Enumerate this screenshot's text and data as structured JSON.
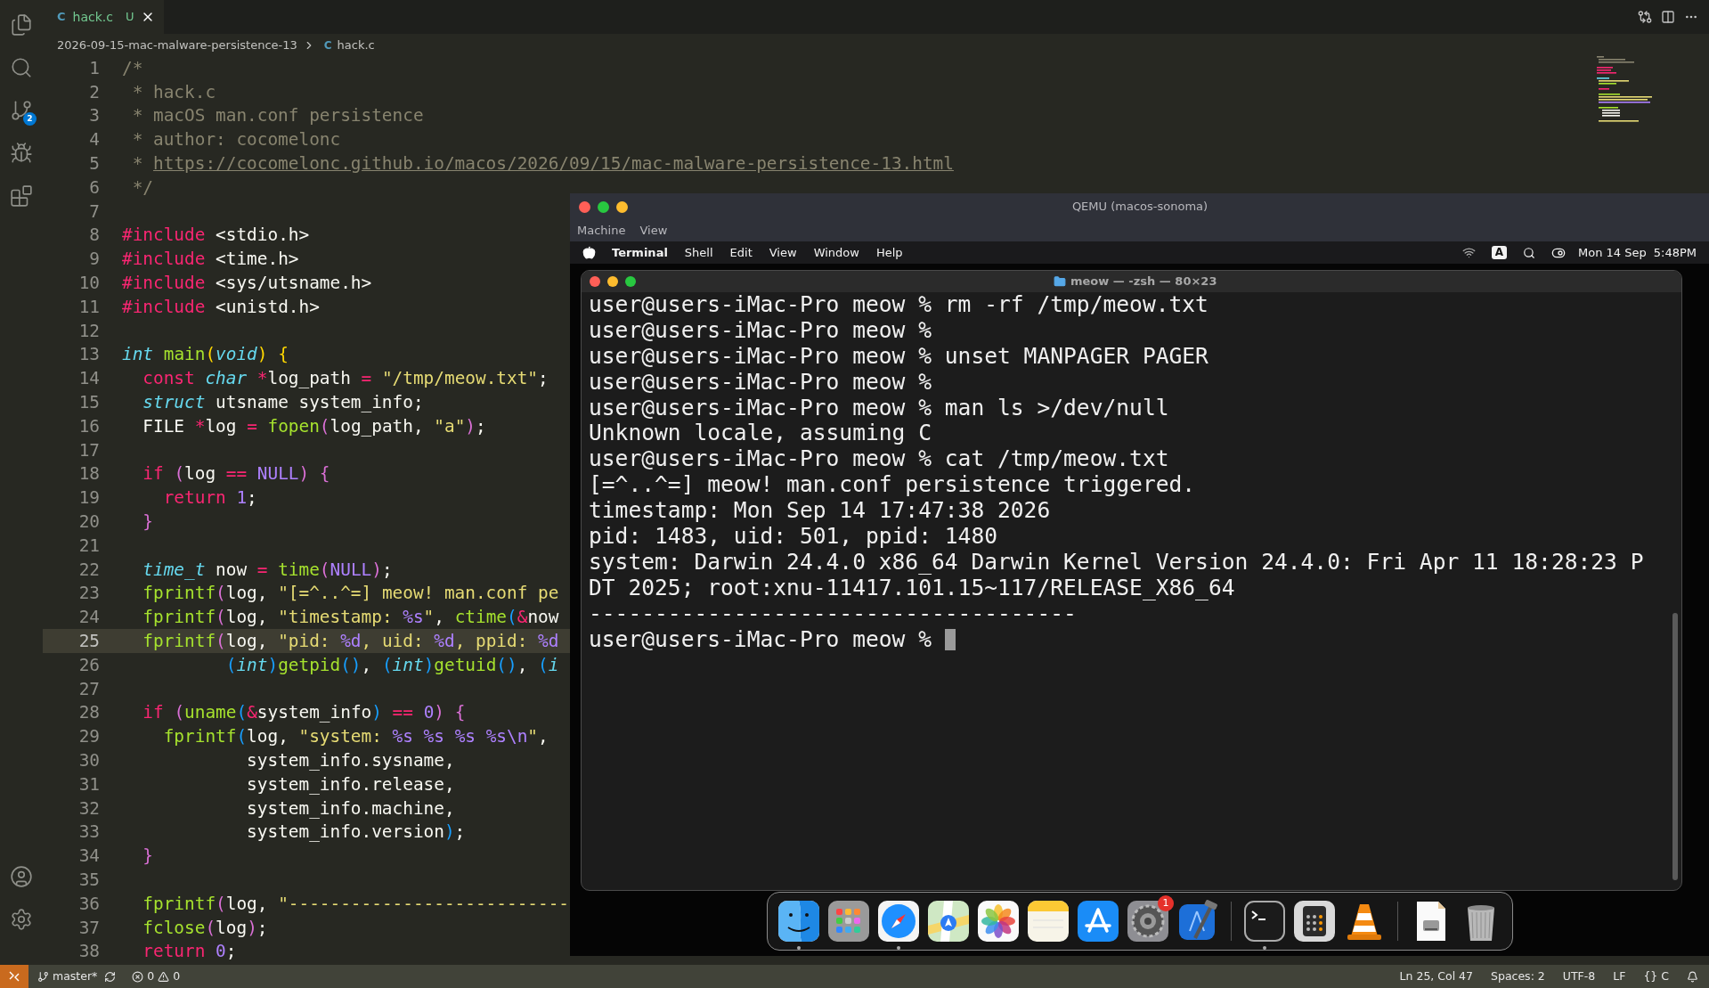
{
  "activity_bar": {
    "top": [
      {
        "kind": "explorer"
      },
      {
        "kind": "search"
      },
      {
        "kind": "source_control",
        "badge": "2"
      },
      {
        "kind": "run_debug"
      },
      {
        "kind": "extensions"
      }
    ],
    "bottom": [
      {
        "kind": "account"
      },
      {
        "kind": "settings"
      }
    ]
  },
  "tabs": [
    {
      "icon": "C",
      "label": "hack.c",
      "status": "U",
      "selected": true
    }
  ],
  "breadcrumb": {
    "folder": "2026-09-15-mac-malware-persistence-13",
    "file_icon": "C",
    "file": "hack.c"
  },
  "code": [
    {
      "number": "1",
      "current": false,
      "tokens": [
        {
          "kind": "comment",
          "text": "/*"
        }
      ]
    },
    {
      "number": "2",
      "current": false,
      "tokens": [
        {
          "kind": "comment",
          "text": " * hack.c"
        }
      ]
    },
    {
      "number": "3",
      "current": false,
      "tokens": [
        {
          "kind": "comment",
          "text": " * macOS man.conf persistence"
        }
      ]
    },
    {
      "number": "4",
      "current": false,
      "tokens": [
        {
          "kind": "comment",
          "text": " * author: cocomelonc"
        }
      ]
    },
    {
      "number": "5",
      "current": false,
      "tokens": [
        {
          "kind": "comment",
          "text": " * "
        },
        {
          "kind": "link",
          "text": "https://cocomelonc.github.io/macos/2026/09/15/mac-malware-persistence-13.html"
        }
      ]
    },
    {
      "number": "6",
      "current": false,
      "tokens": [
        {
          "kind": "comment",
          "text": " */"
        }
      ]
    },
    {
      "number": "7",
      "current": false
    },
    {
      "number": "8",
      "current": false,
      "tokens": [
        {
          "kind": "keyword",
          "text": "#include"
        },
        {
          "kind": "plain",
          "text": " <stdio.h>"
        }
      ]
    },
    {
      "number": "9",
      "current": false,
      "tokens": [
        {
          "kind": "keyword",
          "text": "#include"
        },
        {
          "kind": "plain",
          "text": " <time.h>"
        }
      ]
    },
    {
      "number": "10",
      "current": false,
      "tokens": [
        {
          "kind": "keyword",
          "text": "#include"
        },
        {
          "kind": "plain",
          "text": " <sys/utsname.h>"
        }
      ]
    },
    {
      "number": "11",
      "current": false,
      "tokens": [
        {
          "kind": "keyword",
          "text": "#include"
        },
        {
          "kind": "plain",
          "text": " <unistd.h>"
        }
      ]
    },
    {
      "number": "12",
      "current": false
    },
    {
      "number": "13",
      "current": false,
      "tokens": [
        {
          "kind": "type",
          "text": "int "
        },
        {
          "kind": "function",
          "text": "main"
        },
        {
          "kind": "bracket1",
          "text": "("
        },
        {
          "kind": "type",
          "text": "void"
        },
        {
          "kind": "bracket1",
          "text": ") {"
        }
      ]
    },
    {
      "number": "14",
      "current": false,
      "tokens": [
        {
          "kind": "keyword",
          "text": "  const "
        },
        {
          "kind": "type",
          "text": "char "
        },
        {
          "kind": "keyword",
          "text": "*"
        },
        {
          "kind": "plain",
          "text": "log_path "
        },
        {
          "kind": "keyword",
          "text": "= "
        },
        {
          "kind": "string",
          "text": "\"/tmp/meow.txt\""
        },
        {
          "kind": "plain",
          "text": ";"
        }
      ]
    },
    {
      "number": "15",
      "current": false,
      "tokens": [
        {
          "kind": "type",
          "text": "  struct"
        },
        {
          "kind": "plain",
          "text": " utsname system_info;"
        }
      ]
    },
    {
      "number": "16",
      "current": false,
      "tokens": [
        {
          "kind": "plain",
          "text": "  FILE "
        },
        {
          "kind": "keyword",
          "text": "*"
        },
        {
          "kind": "plain",
          "text": "log "
        },
        {
          "kind": "keyword",
          "text": "= "
        },
        {
          "kind": "function",
          "text": "fopen"
        },
        {
          "kind": "bracket2",
          "text": "("
        },
        {
          "kind": "plain",
          "text": "log_path, "
        },
        {
          "kind": "string",
          "text": "\"a\""
        },
        {
          "kind": "bracket2",
          "text": ")"
        },
        {
          "kind": "plain",
          "text": ";"
        }
      ]
    },
    {
      "number": "17",
      "current": false
    },
    {
      "number": "18",
      "current": false,
      "tokens": [
        {
          "kind": "keyword",
          "text": "  if "
        },
        {
          "kind": "bracket2",
          "text": "("
        },
        {
          "kind": "plain",
          "text": "log "
        },
        {
          "kind": "keyword",
          "text": "== "
        },
        {
          "kind": "constant",
          "text": "NULL"
        },
        {
          "kind": "bracket2",
          "text": ") {"
        }
      ]
    },
    {
      "number": "19",
      "current": false,
      "tokens": [
        {
          "kind": "keyword",
          "text": "    return "
        },
        {
          "kind": "constant",
          "text": "1"
        },
        {
          "kind": "plain",
          "text": ";"
        }
      ]
    },
    {
      "number": "20",
      "current": false,
      "tokens": [
        {
          "kind": "bracket2",
          "text": "  }"
        }
      ]
    },
    {
      "number": "21",
      "current": false
    },
    {
      "number": "22",
      "current": false,
      "tokens": [
        {
          "kind": "type",
          "text": "  time_t"
        },
        {
          "kind": "plain",
          "text": " now "
        },
        {
          "kind": "keyword",
          "text": "= "
        },
        {
          "kind": "function",
          "text": "time"
        },
        {
          "kind": "bracket2",
          "text": "("
        },
        {
          "kind": "constant",
          "text": "NULL"
        },
        {
          "kind": "bracket2",
          "text": ")"
        },
        {
          "kind": "plain",
          "text": ";"
        }
      ]
    },
    {
      "number": "23",
      "current": false,
      "tokens": [
        {
          "kind": "function",
          "text": "  fprintf"
        },
        {
          "kind": "bracket2",
          "text": "("
        },
        {
          "kind": "plain",
          "text": "log, "
        },
        {
          "kind": "string",
          "text": "\"[=^..^=] meow! man.conf pe"
        }
      ]
    },
    {
      "number": "24",
      "current": false,
      "tokens": [
        {
          "kind": "function",
          "text": "  fprintf"
        },
        {
          "kind": "bracket2",
          "text": "("
        },
        {
          "kind": "plain",
          "text": "log, "
        },
        {
          "kind": "string",
          "text": "\"timestamp: "
        },
        {
          "kind": "constant",
          "text": "%s"
        },
        {
          "kind": "string",
          "text": "\""
        },
        {
          "kind": "plain",
          "text": ", "
        },
        {
          "kind": "function",
          "text": "ctime"
        },
        {
          "kind": "bracket3",
          "text": "("
        },
        {
          "kind": "keyword",
          "text": "&"
        },
        {
          "kind": "plain",
          "text": "now"
        }
      ]
    },
    {
      "number": "25",
      "current": true,
      "tokens": [
        {
          "kind": "function",
          "text": "  fprintf"
        },
        {
          "kind": "bracket2",
          "text": "("
        },
        {
          "kind": "plain",
          "text": "log, "
        },
        {
          "kind": "string",
          "text": "\"pid: "
        },
        {
          "kind": "constant",
          "text": "%d"
        },
        {
          "kind": "string",
          "text": ", uid: "
        },
        {
          "kind": "constant",
          "text": "%d"
        },
        {
          "kind": "string",
          "text": ", ppid: "
        },
        {
          "kind": "constant",
          "text": "%d"
        }
      ]
    },
    {
      "number": "26",
      "current": false,
      "tokens": [
        {
          "kind": "bracket3",
          "text": "          ("
        },
        {
          "kind": "type",
          "text": "int"
        },
        {
          "kind": "bracket3",
          "text": ")"
        },
        {
          "kind": "function",
          "text": "getpid"
        },
        {
          "kind": "bracket3",
          "text": "()"
        },
        {
          "kind": "plain",
          "text": ", "
        },
        {
          "kind": "bracket3",
          "text": "("
        },
        {
          "kind": "type",
          "text": "int"
        },
        {
          "kind": "bracket3",
          "text": ")"
        },
        {
          "kind": "function",
          "text": "getuid"
        },
        {
          "kind": "bracket3",
          "text": "()"
        },
        {
          "kind": "plain",
          "text": ", "
        },
        {
          "kind": "bracket3",
          "text": "("
        },
        {
          "kind": "type",
          "text": "i"
        }
      ]
    },
    {
      "number": "27",
      "current": false
    },
    {
      "number": "28",
      "current": false,
      "tokens": [
        {
          "kind": "keyword",
          "text": "  if "
        },
        {
          "kind": "bracket2",
          "text": "("
        },
        {
          "kind": "function",
          "text": "uname"
        },
        {
          "kind": "bracket3",
          "text": "("
        },
        {
          "kind": "keyword",
          "text": "&"
        },
        {
          "kind": "plain",
          "text": "system_info"
        },
        {
          "kind": "bracket3",
          "text": ") "
        },
        {
          "kind": "keyword",
          "text": "== "
        },
        {
          "kind": "constant",
          "text": "0"
        },
        {
          "kind": "bracket2",
          "text": ") {"
        }
      ]
    },
    {
      "number": "29",
      "current": false,
      "tokens": [
        {
          "kind": "function",
          "text": "    fprintf"
        },
        {
          "kind": "bracket3",
          "text": "("
        },
        {
          "kind": "plain",
          "text": "log, "
        },
        {
          "kind": "string",
          "text": "\"system: "
        },
        {
          "kind": "constant",
          "text": "%s "
        },
        {
          "kind": "constant",
          "text": "%s "
        },
        {
          "kind": "constant",
          "text": "%s "
        },
        {
          "kind": "constant",
          "text": "%s\\n"
        },
        {
          "kind": "string",
          "text": "\""
        },
        {
          "kind": "plain",
          "text": ","
        }
      ]
    },
    {
      "number": "30",
      "current": false,
      "tokens": [
        {
          "kind": "plain",
          "text": "            system_info.sysname,"
        }
      ]
    },
    {
      "number": "31",
      "current": false,
      "tokens": [
        {
          "kind": "plain",
          "text": "            system_info.release,"
        }
      ]
    },
    {
      "number": "32",
      "current": false,
      "tokens": [
        {
          "kind": "plain",
          "text": "            system_info.machine,"
        }
      ]
    },
    {
      "number": "33",
      "current": false,
      "tokens": [
        {
          "kind": "plain",
          "text": "            system_info.version"
        },
        {
          "kind": "bracket3",
          "text": ")"
        },
        {
          "kind": "plain",
          "text": ";"
        }
      ]
    },
    {
      "number": "34",
      "current": false,
      "tokens": [
        {
          "kind": "bracket2",
          "text": "  }"
        }
      ]
    },
    {
      "number": "35",
      "current": false
    },
    {
      "number": "36",
      "current": false,
      "tokens": [
        {
          "kind": "function",
          "text": "  fprintf"
        },
        {
          "kind": "bracket2",
          "text": "("
        },
        {
          "kind": "plain",
          "text": "log, "
        },
        {
          "kind": "string",
          "text": "\"---------------------------"
        }
      ]
    },
    {
      "number": "37",
      "current": false,
      "tokens": [
        {
          "kind": "function",
          "text": "  fclose"
        },
        {
          "kind": "bracket2",
          "text": "("
        },
        {
          "kind": "plain",
          "text": "log"
        },
        {
          "kind": "bracket2",
          "text": ")"
        },
        {
          "kind": "plain",
          "text": ";"
        }
      ]
    },
    {
      "number": "38",
      "current": false,
      "tokens": [
        {
          "kind": "keyword",
          "text": "  return "
        },
        {
          "kind": "constant",
          "text": "0"
        },
        {
          "kind": "plain",
          "text": ";"
        }
      ]
    }
  ],
  "qemu": {
    "title": "QEMU (macos-sonoma)",
    "menu": [
      "Machine",
      "View"
    ],
    "mac_menu_bar": {
      "app": "Terminal",
      "items": [
        "Shell",
        "Edit",
        "View",
        "Window",
        "Help"
      ],
      "input_source": "A",
      "date": "Mon 14 Sep",
      "time": "5:48PM"
    },
    "terminal": {
      "title": "meow — -zsh — 80×23",
      "lines": [
        "user@users-iMac-Pro meow % rm -rf /tmp/meow.txt",
        "user@users-iMac-Pro meow %",
        "user@users-iMac-Pro meow % unset MANPAGER PAGER",
        "user@users-iMac-Pro meow %",
        "user@users-iMac-Pro meow % man ls >/dev/null",
        "Unknown locale, assuming C",
        "user@users-iMac-Pro meow % cat /tmp/meow.txt",
        "[=^..^=] meow! man.conf persistence triggered.",
        "timestamp: Mon Sep 14 17:47:38 2026",
        "pid: 1483, uid: 501, ppid: 1480",
        "system: Darwin 24.4.0 x86_64 Darwin Kernel Version 24.4.0: Fri Apr 11 18:28:23 P",
        "DT 2025; root:xnu-11417.101.15~117/RELEASE_X86_64",
        "-------------------------------------"
      ],
      "prompt": "user@users-iMac-Pro meow %",
      "cursor_visible": true
    },
    "dock": [
      {
        "kind": "finder",
        "running": true
      },
      {
        "kind": "launchpad",
        "running": false
      },
      {
        "kind": "safari",
        "running": true
      },
      {
        "kind": "maps",
        "running": false
      },
      {
        "kind": "photos",
        "running": false
      },
      {
        "kind": "notes",
        "running": false
      },
      {
        "kind": "appstore",
        "running": false
      },
      {
        "kind": "settings",
        "running": false,
        "badge": "1"
      },
      {
        "kind": "xcode",
        "running": false
      },
      {
        "kind": "separator"
      },
      {
        "kind": "terminal",
        "running": true
      },
      {
        "kind": "calculator",
        "running": false
      },
      {
        "kind": "vlc",
        "running": false
      },
      {
        "kind": "separator"
      },
      {
        "kind": "document",
        "running": false
      },
      {
        "kind": "trash",
        "running": false
      }
    ]
  },
  "status_bar": {
    "branch": "master*",
    "errors": "0",
    "warnings": "0",
    "right": [
      "Ln 25, Col 47",
      "Spaces: 2",
      "UTF-8",
      "LF",
      "{} C"
    ]
  }
}
